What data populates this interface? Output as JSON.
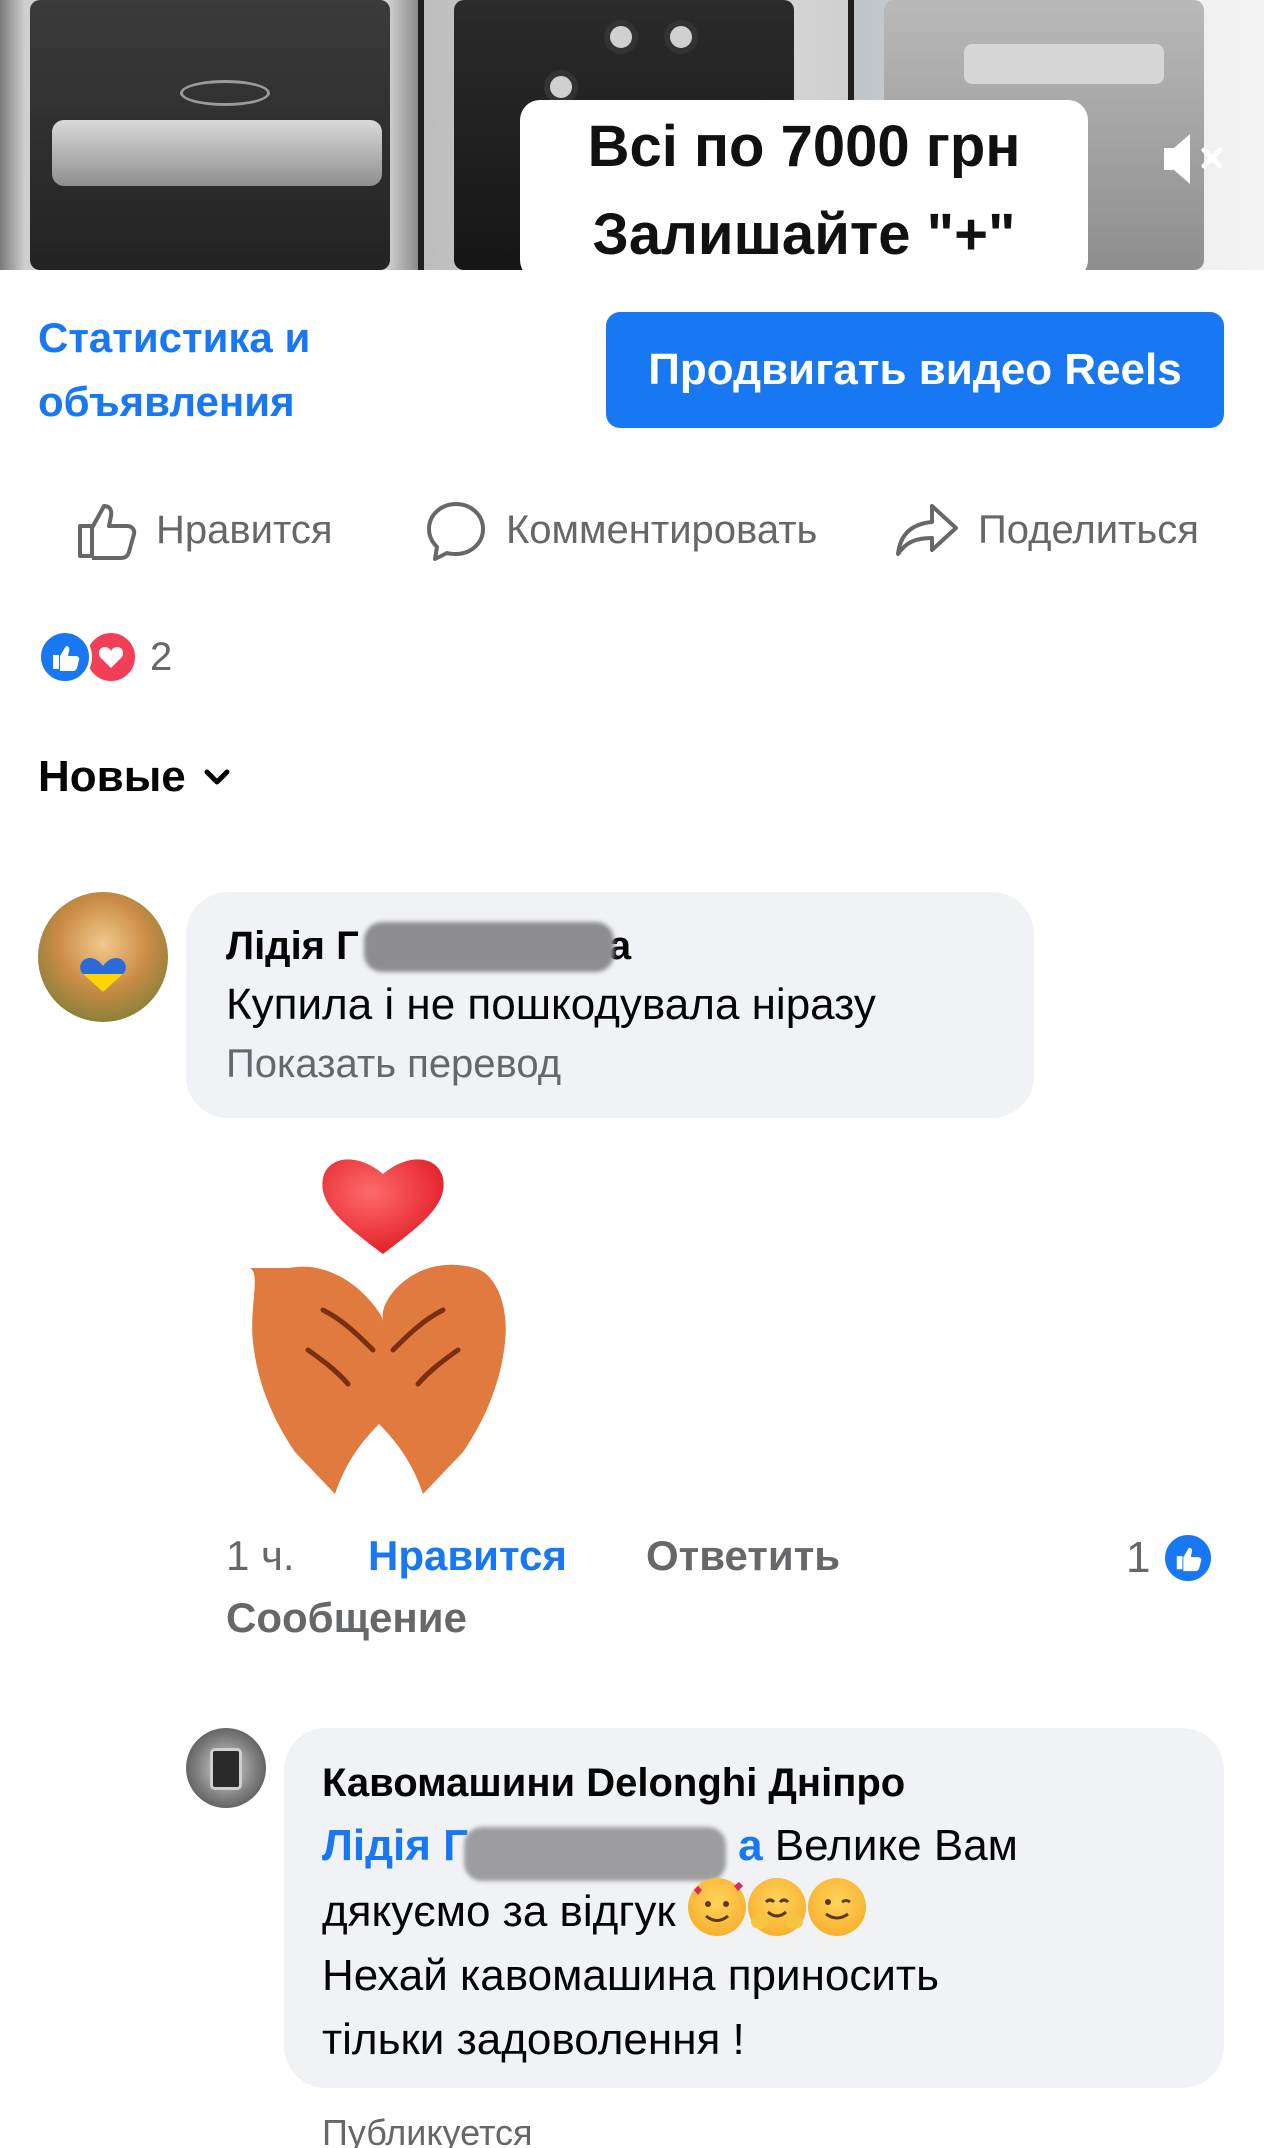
{
  "video": {
    "overlay_line1": "Всі по 7000 грн",
    "overlay_line2": "Залишайте \"+\"",
    "mute_icon": "speaker-muted-icon"
  },
  "actions": {
    "stats_link": "Статистика и объявления",
    "promote_button": "Продвигать видео Reels"
  },
  "reaction_bar": {
    "like": "Нравится",
    "comment": "Комментировать",
    "share": "Поделиться"
  },
  "reactions": {
    "types": [
      "like-icon",
      "love-icon"
    ],
    "count": "2"
  },
  "sort": {
    "label": "Новые"
  },
  "comments": [
    {
      "author": "Лідія Г",
      "author_tail": "а",
      "text": "Купила і не пошкодувала ніразу",
      "translate": "Показать перевод",
      "sticker": "heart-hands-sticker",
      "time": "1 ч.",
      "like": "Нравится",
      "reply": "Ответить",
      "message": "Сообщение",
      "like_count": "1"
    }
  ],
  "reply": {
    "author": "Кавомашини Delonghi Дніпро",
    "mention_start": "Лідія Г",
    "mention_end": "а",
    "text_1": " Велике Вам",
    "text_2": "дякуємо за відгук ",
    "text_3": "Нехай кавомашина приносить",
    "text_4": "тільки задоволення !",
    "status": "Публикуется"
  },
  "colors": {
    "accent": "#1877f2",
    "love": "#f33e58",
    "bubble": "#f0f2f5",
    "secondary_text": "#65676b"
  }
}
